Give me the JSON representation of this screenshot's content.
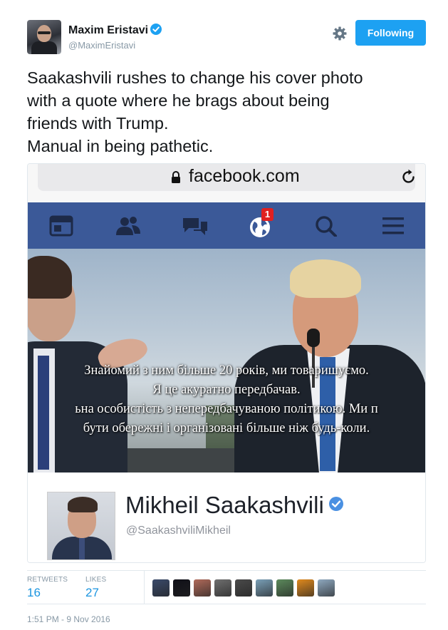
{
  "tweet": {
    "author_name": "Maxim Eristavi",
    "author_handle": "@MaximEristavi",
    "follow_button_label": "Following",
    "text": "Saakashvili rushes to change his cover photo\nwith a quote where he brags about being\nfriends with Trump.\nManual in being pathetic.",
    "timestamp": "1:51 PM - 9 Nov 2016"
  },
  "embedded_screenshot": {
    "url": "facebook.com",
    "nav_icons": [
      "news-feed-icon",
      "friends-icon",
      "messages-icon",
      "notifications-globe-icon",
      "search-icon",
      "menu-icon"
    ],
    "notification_count": "1",
    "cover_quote": "Знайомий з ним більше 20 років, ми товаришуємо.\nЯ це акуратно передбачав.\nьна особистість з непередбачуваною політикою. Ми п\nбути обережні і організовані більше ніж будь-коли.",
    "profile_name": "Mikheil Saakashvili",
    "profile_handle": "@SaakashviliMikheil"
  },
  "stats": {
    "retweets_label": "RETWEETS",
    "retweets_value": "16",
    "likes_label": "LIKES",
    "likes_value": "27"
  },
  "likers": [
    {
      "name": "liker-avatar-1",
      "color": "#3a4a6a"
    },
    {
      "name": "liker-avatar-2",
      "color": "#101018"
    },
    {
      "name": "liker-avatar-3",
      "color": "#b06a5a"
    },
    {
      "name": "liker-avatar-4",
      "color": "#6f6f6f"
    },
    {
      "name": "liker-avatar-5",
      "color": "#4a4a4a"
    },
    {
      "name": "liker-avatar-6",
      "color": "#7aa0b8"
    },
    {
      "name": "liker-avatar-7",
      "color": "#5c8a5c"
    },
    {
      "name": "liker-avatar-8",
      "color": "#e08a1e"
    },
    {
      "name": "liker-avatar-9",
      "color": "#8fa9c0"
    }
  ],
  "colors": {
    "twitter_blue": "#1da1f2",
    "facebook_blue": "#3b5998",
    "muted_text": "#8899a6",
    "verified_badge": "#1da1f2"
  }
}
